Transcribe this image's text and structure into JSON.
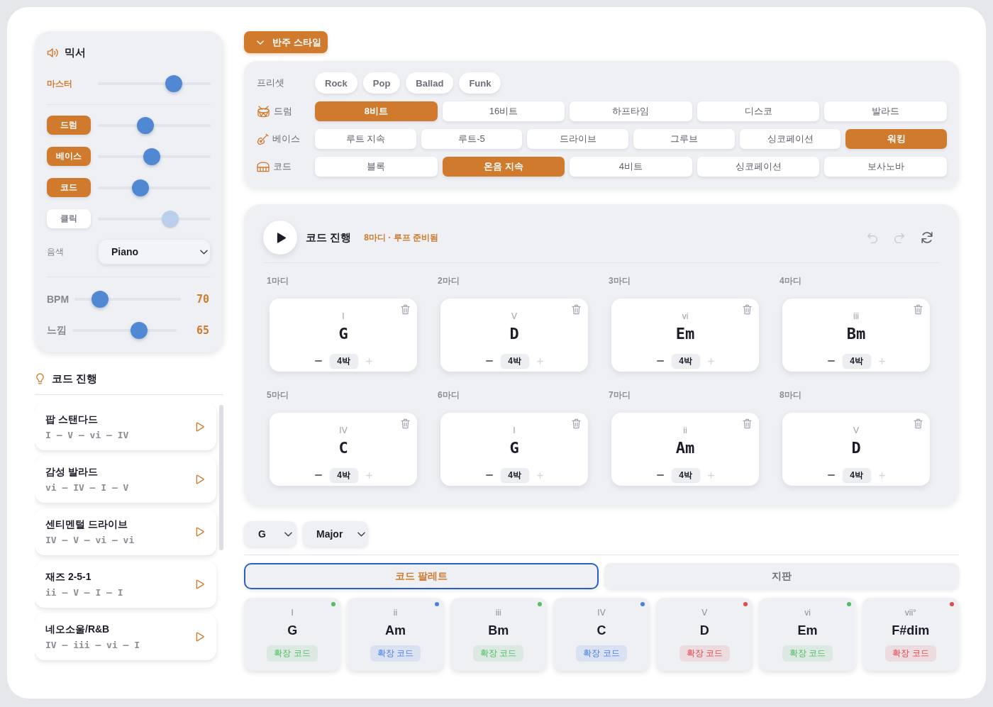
{
  "mixer": {
    "title": "믹서",
    "master": {
      "label": "마스터",
      "level": 0.67
    },
    "channels": [
      {
        "label": "드럼",
        "on": true,
        "level": 0.42
      },
      {
        "label": "베이스",
        "on": true,
        "level": 0.48
      },
      {
        "label": "코드",
        "on": true,
        "level": 0.38
      },
      {
        "label": "클릭",
        "on": false,
        "level": 0.64
      }
    ],
    "instrument": {
      "label": "음색",
      "value": "Piano"
    },
    "bpm": {
      "label": "BPM",
      "level": 0.24,
      "value": "70"
    },
    "feel": {
      "label": "느낌",
      "level": 0.64,
      "value": "65"
    }
  },
  "progressions": {
    "title": "코드 진행",
    "items": [
      {
        "name": "팝 스탠다드",
        "pattern": "I – V – vi – IV"
      },
      {
        "name": "감성 발라드",
        "pattern": "vi – IV – I – V"
      },
      {
        "name": "센티멘털 드라이브",
        "pattern": "IV – V – vi – vi"
      },
      {
        "name": "재즈 2-5-1",
        "pattern": "ii – V – I – I"
      },
      {
        "name": "네오소울/R&B",
        "pattern": "IV – iii – vi – I"
      }
    ]
  },
  "style_toggle": {
    "label": "반주 스타일"
  },
  "style": {
    "presets": {
      "label": "프리셋",
      "items": [
        "Rock",
        "Pop",
        "Ballad",
        "Funk"
      ]
    },
    "rows": [
      {
        "kind": "drum",
        "label": "드럼",
        "options": [
          {
            "label": "8비트",
            "selected": true
          },
          {
            "label": "16비트",
            "selected": false
          },
          {
            "label": "하프타임",
            "selected": false
          },
          {
            "label": "디스코",
            "selected": false
          },
          {
            "label": "발라드",
            "selected": false
          }
        ]
      },
      {
        "kind": "bass",
        "label": "베이스",
        "options": [
          {
            "label": "루트 지속",
            "selected": false
          },
          {
            "label": "루트-5",
            "selected": false
          },
          {
            "label": "드라이브",
            "selected": false
          },
          {
            "label": "그루브",
            "selected": false
          },
          {
            "label": "싱코페이션",
            "selected": false
          },
          {
            "label": "워킹",
            "selected": true
          }
        ]
      },
      {
        "kind": "chord",
        "label": "코드",
        "options": [
          {
            "label": "블록",
            "selected": false
          },
          {
            "label": "온음 지속",
            "selected": true
          },
          {
            "label": "4비트",
            "selected": false
          },
          {
            "label": "싱코페이션",
            "selected": false
          },
          {
            "label": "보사노바",
            "selected": false
          }
        ]
      }
    ]
  },
  "progression": {
    "title": "코드 진행",
    "status": "8마디 · 루프 준비됨",
    "history": {
      "can_undo": false,
      "can_redo": false
    },
    "bars": [
      {
        "label": "1마디",
        "numeral": "I",
        "chord": "G",
        "beats": "4박",
        "can_increase": false
      },
      {
        "label": "2마디",
        "numeral": "V",
        "chord": "D",
        "beats": "4박",
        "can_increase": false
      },
      {
        "label": "3마디",
        "numeral": "vi",
        "chord": "Em",
        "beats": "4박",
        "can_increase": false
      },
      {
        "label": "4마디",
        "numeral": "iii",
        "chord": "Bm",
        "beats": "4박",
        "can_increase": false
      },
      {
        "label": "5마디",
        "numeral": "IV",
        "chord": "C",
        "beats": "4박",
        "can_increase": false
      },
      {
        "label": "6마디",
        "numeral": "I",
        "chord": "G",
        "beats": "4박",
        "can_increase": false
      },
      {
        "label": "7마디",
        "numeral": "ii",
        "chord": "Am",
        "beats": "4박",
        "can_increase": false
      },
      {
        "label": "8마디",
        "numeral": "V",
        "chord": "D",
        "beats": "4박",
        "can_increase": false
      }
    ]
  },
  "key_select": {
    "root": "G",
    "mode": "Major"
  },
  "palette_tabs": [
    {
      "label": "코드 팔레트",
      "selected": true
    },
    {
      "label": "지판",
      "selected": false
    }
  ],
  "palette": [
    {
      "numeral": "I",
      "chord": "G",
      "tag": "확장 코드",
      "color": "#4fbf62"
    },
    {
      "numeral": "ii",
      "chord": "Am",
      "tag": "확장 코드",
      "color": "#4a80e4"
    },
    {
      "numeral": "iii",
      "chord": "Bm",
      "tag": "확장 코드",
      "color": "#4fbf62"
    },
    {
      "numeral": "IV",
      "chord": "C",
      "tag": "확장 코드",
      "color": "#4a80e4"
    },
    {
      "numeral": "V",
      "chord": "D",
      "tag": "확장 코드",
      "color": "#e04a4a"
    },
    {
      "numeral": "vi",
      "chord": "Em",
      "tag": "확장 코드",
      "color": "#4fbf62"
    },
    {
      "numeral": "vii°",
      "chord": "F#dim",
      "tag": "확장 코드",
      "color": "#e04a4a"
    }
  ]
}
